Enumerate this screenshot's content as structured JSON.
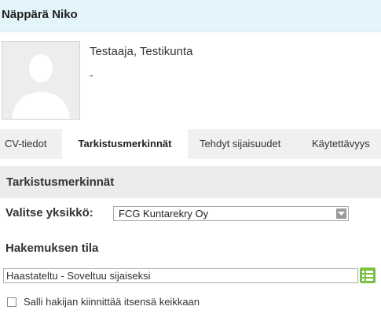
{
  "header": {
    "name": "Näppärä Niko"
  },
  "profile": {
    "role": "Testaaja, Testikunta",
    "secondary": "-"
  },
  "tabs": [
    {
      "label": "CV-tiedot",
      "active": false
    },
    {
      "label": "Tarkistusmerkinnät",
      "active": true
    },
    {
      "label": "Tehdyt sijaisuudet",
      "active": false
    },
    {
      "label": "Käytettävyys",
      "active": false
    }
  ],
  "section": {
    "title": "Tarkistusmerkinnät"
  },
  "unit": {
    "label": "Valitse yksikkö:",
    "selected": "FCG Kuntarekry Oy"
  },
  "application": {
    "label": "Hakemuksen tila",
    "value": "Haastateltu - Soveltuu sijaiseksi"
  },
  "option": {
    "label": "Salli hakijan kiinnittää itsensä keikkaan",
    "checked": false
  },
  "colors": {
    "header_bg": "#e3f4fb",
    "tabbar_bg": "#f0f0f0",
    "section_bg": "#ececec",
    "list_button": "#7ac143"
  },
  "icons": {
    "avatar": "person-silhouette-icon",
    "dropdown": "chevron-down-icon",
    "list": "list-icon"
  }
}
